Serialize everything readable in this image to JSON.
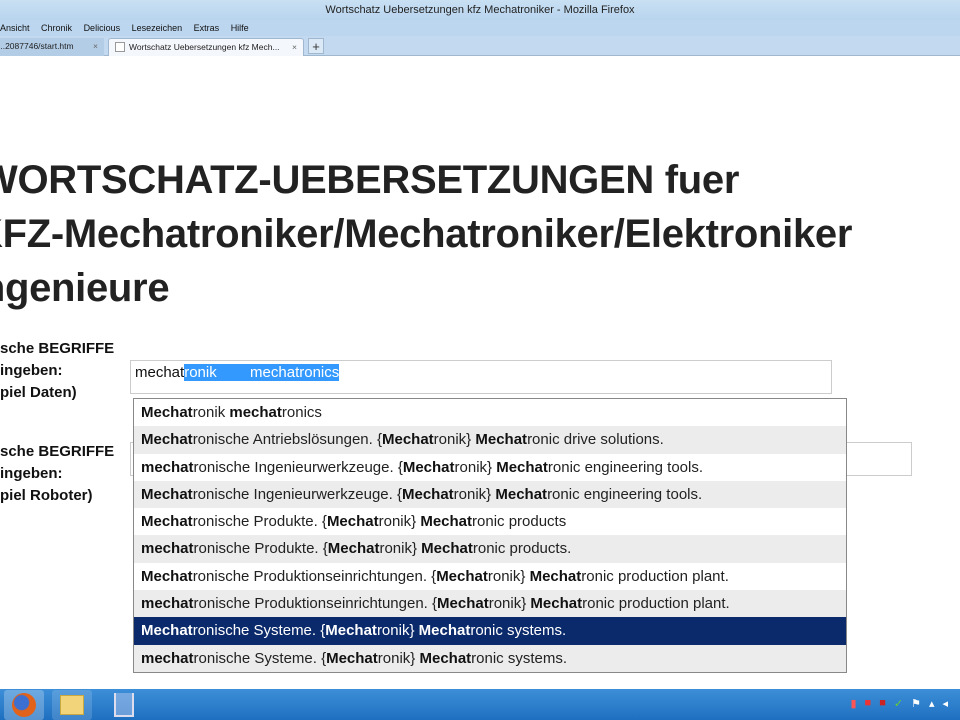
{
  "window": {
    "title": "Wortschatz Uebersetzungen kfz Mechatroniker - Mozilla Firefox"
  },
  "menu": [
    "Ansicht",
    "Chronik",
    "Delicious",
    "Lesezeichen",
    "Extras",
    "Hilfe"
  ],
  "tabs": [
    {
      "label": "...2087746/start.htm"
    },
    {
      "label": "Wortschatz Uebersetzungen kfz Mech..."
    }
  ],
  "page": {
    "heading_lines": [
      "WORTSCHATZ-UEBERSETZUNGEN fuer",
      "KFZ-Mechatroniker/Mechatroniker/Elektroniker",
      "Ingenieure"
    ],
    "label1": [
      "sche BEGRIFFE",
      "ingeben:",
      "piel Daten)"
    ],
    "label2": [
      "sche BEGRIFFE",
      "ingeben:",
      "piel Roboter)"
    ],
    "input1": {
      "typed": "mechat",
      "selected": "ronik        mechatronics"
    }
  },
  "suggestions": [
    [
      [
        "Mechat",
        1
      ],
      [
        "ronik ",
        0
      ],
      [
        "mechat",
        1
      ],
      [
        "ronics",
        0
      ]
    ],
    [
      [
        "Mechat",
        1
      ],
      [
        "ronische Antriebslösungen. {",
        0
      ],
      [
        "Mechat",
        1
      ],
      [
        "ronik} ",
        0
      ],
      [
        "Mechat",
        1
      ],
      [
        "ronic drive solutions.",
        0
      ]
    ],
    [
      [
        "mechat",
        1
      ],
      [
        "ronische Ingenieurwerkzeuge. {",
        0
      ],
      [
        "Mechat",
        1
      ],
      [
        "ronik} ",
        0
      ],
      [
        "Mechat",
        1
      ],
      [
        "ronic engineering tools.",
        0
      ]
    ],
    [
      [
        "Mechat",
        1
      ],
      [
        "ronische Ingenieurwerkzeuge. {",
        0
      ],
      [
        "Mechat",
        1
      ],
      [
        "ronik} ",
        0
      ],
      [
        "Mechat",
        1
      ],
      [
        "ronic engineering tools.",
        0
      ]
    ],
    [
      [
        "Mechat",
        1
      ],
      [
        "ronische Produkte. {",
        0
      ],
      [
        "Mechat",
        1
      ],
      [
        "ronik} ",
        0
      ],
      [
        "Mechat",
        1
      ],
      [
        "ronic products",
        0
      ]
    ],
    [
      [
        "mechat",
        1
      ],
      [
        "ronische Produkte. {",
        0
      ],
      [
        "Mechat",
        1
      ],
      [
        "ronik} ",
        0
      ],
      [
        "Mechat",
        1
      ],
      [
        "ronic products.",
        0
      ]
    ],
    [
      [
        "Mechat",
        1
      ],
      [
        "ronische Produktionseinrichtungen. {",
        0
      ],
      [
        "Mechat",
        1
      ],
      [
        "ronik} ",
        0
      ],
      [
        "Mechat",
        1
      ],
      [
        "ronic production plant.",
        0
      ]
    ],
    [
      [
        "mechat",
        1
      ],
      [
        "ronische Produktionseinrichtungen. {",
        0
      ],
      [
        "Mechat",
        1
      ],
      [
        "ronik} ",
        0
      ],
      [
        "Mechat",
        1
      ],
      [
        "ronic production plant.",
        0
      ]
    ],
    [
      [
        "Mechat",
        1
      ],
      [
        "ronische Systeme. {",
        0
      ],
      [
        "Mechat",
        1
      ],
      [
        "ronik} ",
        0
      ],
      [
        "Mechat",
        1
      ],
      [
        "ronic systems.",
        0
      ]
    ],
    [
      [
        "mechat",
        1
      ],
      [
        "ronische Systeme. {",
        0
      ],
      [
        "Mechat",
        1
      ],
      [
        "ronik} ",
        0
      ],
      [
        "Mechat",
        1
      ],
      [
        "ronic systems.",
        0
      ]
    ]
  ],
  "highlighted_index": 8,
  "colors": {
    "highlight": "#0b2a6b",
    "selection": "#3399ff",
    "taskbar": "#2a7fcf"
  }
}
